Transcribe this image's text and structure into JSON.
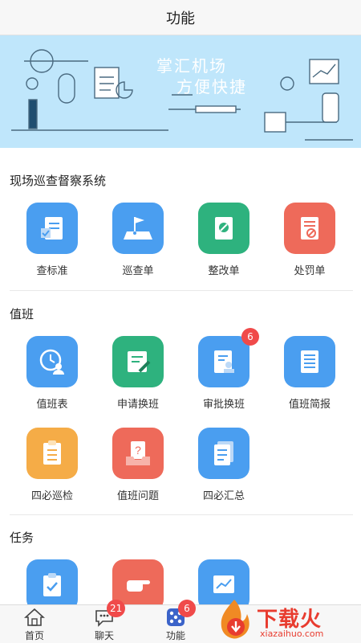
{
  "header": {
    "title": "功能"
  },
  "banner": {
    "line1": "掌汇机场",
    "line2": "方便快捷"
  },
  "sections": [
    {
      "title": "现场巡查督察系统",
      "items": [
        {
          "label": "查标准",
          "icon": "clipboard-check-icon",
          "color": "#4a9ef0"
        },
        {
          "label": "巡查单",
          "icon": "map-flag-icon",
          "color": "#4a9ef0"
        },
        {
          "label": "整改单",
          "icon": "wrench-document-icon",
          "color": "#2eb27e"
        },
        {
          "label": "处罚单",
          "icon": "penalty-scroll-icon",
          "color": "#ee6a5a"
        }
      ]
    },
    {
      "title": "值班",
      "items": [
        {
          "label": "值班表",
          "icon": "clock-person-icon",
          "color": "#4a9ef0"
        },
        {
          "label": "申请换班",
          "icon": "edit-document-icon",
          "color": "#2eb27e"
        },
        {
          "label": "审批换班",
          "icon": "stamp-document-icon",
          "color": "#4a9ef0",
          "badge": "6"
        },
        {
          "label": "值班简报",
          "icon": "report-document-icon",
          "color": "#4a9ef0"
        },
        {
          "label": "四必巡检",
          "icon": "checklist-board-icon",
          "color": "#f5ac47"
        },
        {
          "label": "值班问题",
          "icon": "question-inbox-icon",
          "color": "#ee6a5a"
        },
        {
          "label": "四必汇总",
          "icon": "summary-documents-icon",
          "color": "#4a9ef0"
        }
      ]
    },
    {
      "title": "任务",
      "items": [
        {
          "label": "",
          "icon": "task-clipboard-icon",
          "color": "#4a9ef0"
        },
        {
          "label": "",
          "icon": "pointing-hand-icon",
          "color": "#ee6a5a"
        },
        {
          "label": "",
          "icon": "chart-screen-icon",
          "color": "#4a9ef0"
        }
      ]
    }
  ],
  "tabbar": [
    {
      "label": "首页",
      "icon": "home-icon"
    },
    {
      "label": "聊天",
      "icon": "chat-icon",
      "badge": "21"
    },
    {
      "label": "功能",
      "icon": "grid-apps-icon",
      "badge": "6",
      "active": true
    },
    {
      "label": "",
      "icon": "partially-hidden-tab-icon"
    }
  ],
  "watermark": {
    "brand": "下载火",
    "domain": "xiazaihuo.com"
  }
}
